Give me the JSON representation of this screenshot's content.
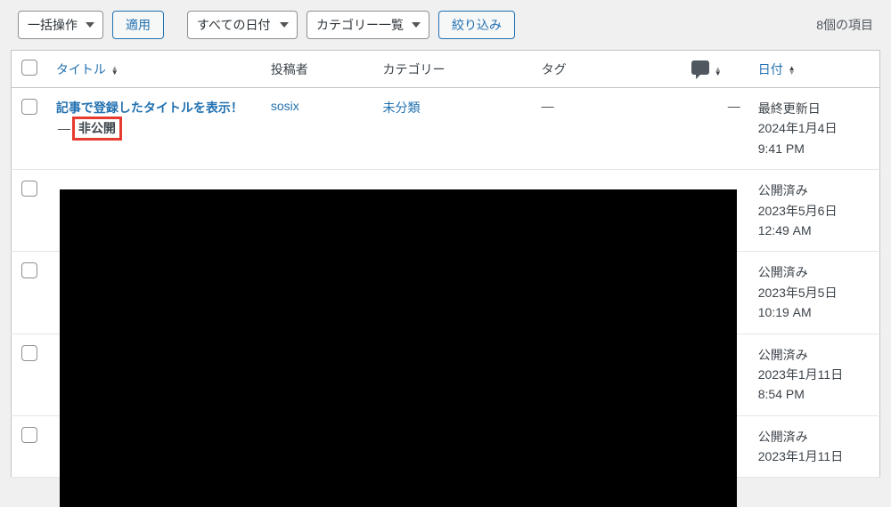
{
  "toolbar": {
    "bulk_action": "一括操作",
    "apply": "適用",
    "date_filter": "すべての日付",
    "category_filter": "カテゴリー一覧",
    "filter": "絞り込み",
    "item_count": "8個の項目"
  },
  "columns": {
    "title": "タイトル",
    "author": "投稿者",
    "category": "カテゴリー",
    "tag": "タグ",
    "date": "日付"
  },
  "rows": [
    {
      "title": "記事で登録したタイトルを表示！",
      "status_sep": "—",
      "status": "非公開",
      "author": "sosix",
      "category": "未分類",
      "tag": "—",
      "comments": "—",
      "date_status": "最終更新日",
      "date_line1": "2024年1月4日",
      "date_line2": "9:41 PM",
      "highlight": true
    },
    {
      "title": "",
      "author": "",
      "category": "",
      "tag": "",
      "comments": "",
      "date_status": "公開済み",
      "date_line1": "2023年5月6日",
      "date_line2": "12:49 AM"
    },
    {
      "title": "",
      "date_status": "公開済み",
      "date_line1": "2023年5月5日",
      "date_line2": "10:19 AM"
    },
    {
      "title": "",
      "date_status": "公開済み",
      "date_line1": "2023年1月11日",
      "date_line2": "8:54 PM"
    },
    {
      "title": "",
      "date_status": "公開済み",
      "date_line1": "2023年1月11日",
      "date_line2": ""
    }
  ]
}
